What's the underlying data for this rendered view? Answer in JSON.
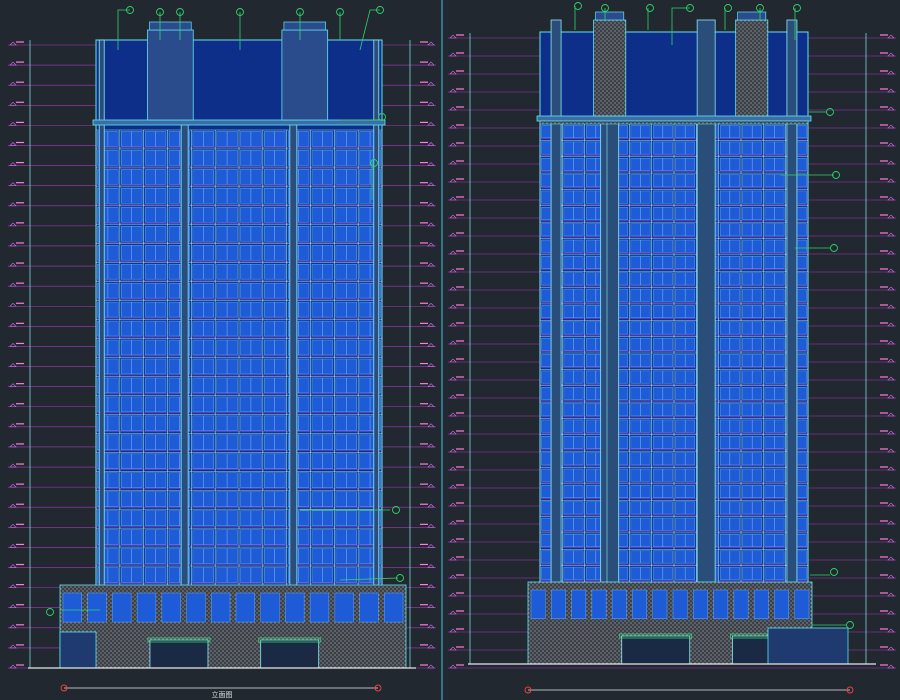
{
  "canvas": {
    "background": "#212830"
  },
  "colors": {
    "level_line": "#c23ad8",
    "level_tick": "#d96bf0",
    "facade_blue": "#1e5bd6",
    "facade_deep": "#0d2f8a",
    "outline_cyan": "#5fe3f0",
    "pier_cyan": "#8fe9f2",
    "leader_green": "#2fd36a",
    "stone_hatch": "#8a8e96",
    "divider": "#3fa7c9",
    "ground": "#e8e8e8",
    "red_mark": "#ff3b3b"
  },
  "drawings": [
    {
      "id": "elevation-left",
      "type": "building-elevation",
      "floors": 24,
      "bays": 12,
      "caption": "立面图"
    },
    {
      "id": "elevation-right",
      "type": "building-elevation",
      "floors": 28,
      "bays": 12,
      "caption": ""
    }
  ]
}
